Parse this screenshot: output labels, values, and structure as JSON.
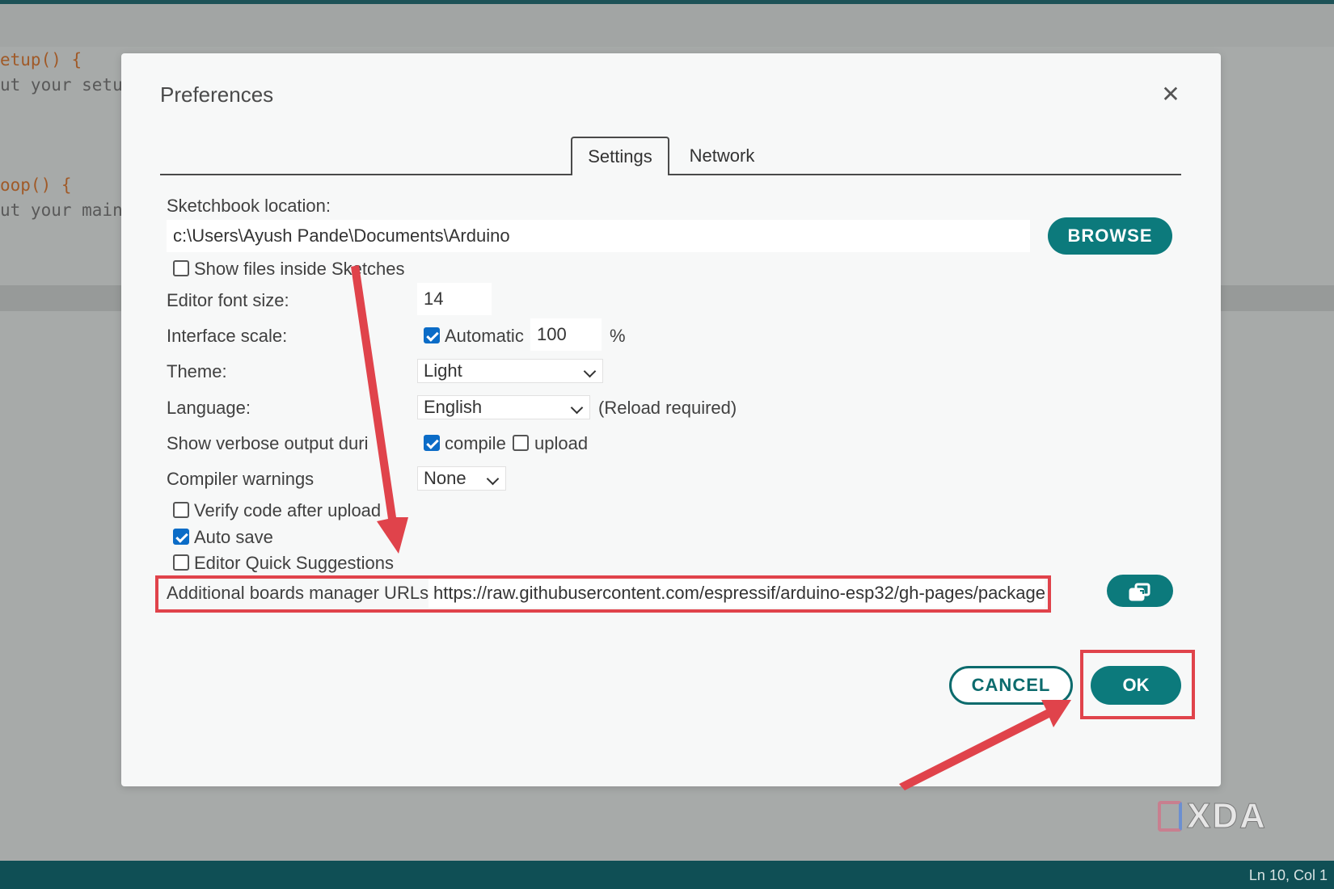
{
  "editor": {
    "lines": [
      "etup() {",
      "ut your setu",
      "oop() {",
      "ut your main"
    ]
  },
  "dialog": {
    "title": "Preferences",
    "close_icon": "close-icon",
    "tabs": [
      {
        "label": "Settings",
        "active": true
      },
      {
        "label": "Network",
        "active": false
      }
    ],
    "sketchbook": {
      "label": "Sketchbook location:",
      "value": "c:\\Users\\Ayush Pande\\Documents\\Arduino",
      "browse_label": "BROWSE"
    },
    "show_files": {
      "label": "Show files inside Sketches",
      "checked": false
    },
    "font_size": {
      "label": "Editor font size:",
      "value": "14"
    },
    "interface_scale": {
      "label": "Interface scale:",
      "automatic_label": "Automatic",
      "automatic_checked": true,
      "value": "100",
      "unit": "%"
    },
    "theme": {
      "label": "Theme:",
      "selected": "Light"
    },
    "language": {
      "label": "Language:",
      "selected": "English",
      "note": "(Reload required)"
    },
    "verbose": {
      "label": "Show verbose output duri",
      "compile_label": "compile",
      "compile_checked": true,
      "upload_label": "upload",
      "upload_checked": false
    },
    "compiler_warnings": {
      "label": "Compiler warnings",
      "selected": "None"
    },
    "verify_code": {
      "label": "Verify code after upload",
      "checked": false
    },
    "auto_save": {
      "label": "Auto save",
      "checked": true
    },
    "quick_suggestions": {
      "label": "Editor Quick Suggestions",
      "checked": false
    },
    "boards_urls": {
      "label": "Additional boards manager URLs:",
      "value": "https://raw.githubusercontent.com/espressif/arduino-esp32/gh-pages/package…",
      "edit_icon": "open-window-icon"
    },
    "buttons": {
      "cancel": "CANCEL",
      "ok": "OK"
    }
  },
  "status_bar": {
    "position": "Ln 10, Col 1"
  },
  "watermark": "XDA",
  "colors": {
    "accent": "#0c7a7c",
    "highlight": "#e0434b",
    "status_bar": "#0f4f55"
  }
}
